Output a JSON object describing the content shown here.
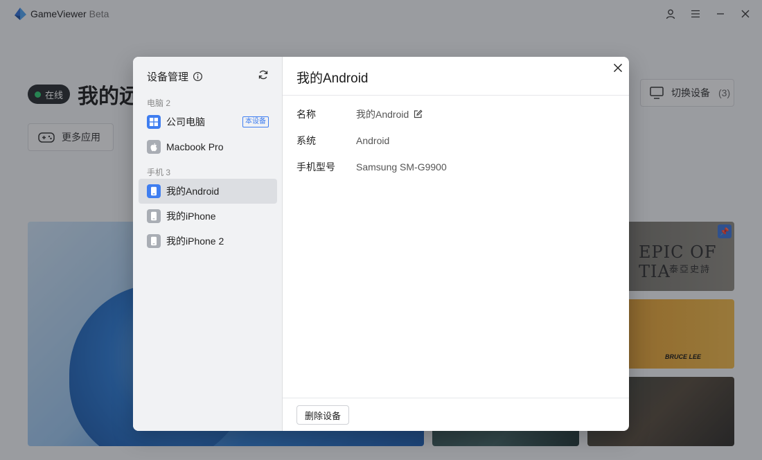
{
  "app": {
    "name": "GameViewer",
    "beta_label": "Beta"
  },
  "main": {
    "status_label": "在线",
    "device_title": "我的远",
    "more_apps_label": "更多应用",
    "switch_device_label": "切换设备",
    "switch_device_count": "(3)",
    "game_cards": [
      {
        "title": "EPIC OF TIA",
        "subtitle": "泰亞史詩"
      },
      {
        "title": "",
        "brand": "BRUCE LEE"
      }
    ]
  },
  "modal": {
    "sidebar_title": "设备管理",
    "groups": [
      {
        "label": "电脑 2",
        "items": [
          {
            "label": "公司电脑",
            "badge": "本设备",
            "icon": "windows-icon"
          },
          {
            "label": "Macbook Pro",
            "icon": "apple-icon"
          }
        ]
      },
      {
        "label": "手机 3",
        "items": [
          {
            "label": "我的Android",
            "icon": "phone-icon",
            "active": true
          },
          {
            "label": "我的iPhone",
            "icon": "phone-icon"
          },
          {
            "label": "我的iPhone 2",
            "icon": "phone-icon"
          }
        ]
      }
    ],
    "detail": {
      "title": "我的Android",
      "fields": [
        {
          "key": "名称",
          "value": "我的Android"
        },
        {
          "key": "系统",
          "value": "Android"
        },
        {
          "key": "手机型号",
          "value": "Samsung SM-G9900"
        }
      ],
      "delete_label": "删除设备"
    }
  },
  "colors": {
    "accent": "#3f7ef0",
    "online": "#2ecc71"
  }
}
